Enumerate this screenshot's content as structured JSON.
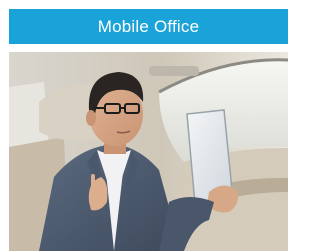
{
  "card": {
    "title": "Mobile Office",
    "image_alt_icon": "photo-icon"
  },
  "colors": {
    "header_bg": "#1aa3d8",
    "header_text": "#ffffff"
  }
}
